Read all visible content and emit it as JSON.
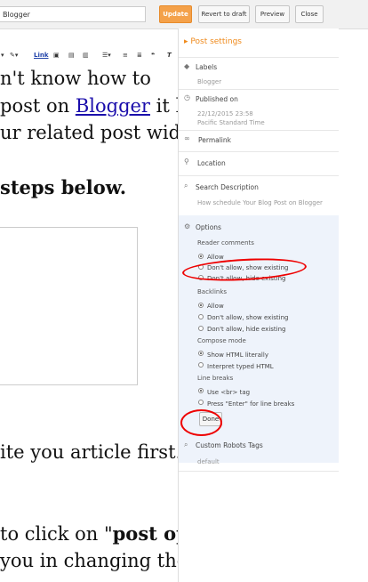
{
  "topbar": {
    "title_value": "Blogger",
    "update_label": "Update",
    "draft_label": "Revert to draft",
    "preview_label": "Preview",
    "close_label": "Close"
  },
  "toolbar": {
    "link_label": "Link"
  },
  "editor": {
    "lines": [
      {
        "text": "n't know how to"
      },
      {
        "prefix": "post on ",
        "link": "Blogger",
        "suffix": " it h"
      },
      {
        "text": "ur related post widg"
      },
      {
        "text": " steps below."
      },
      {
        "text": "ite you article first."
      },
      {
        "prefix": "to click on  \"",
        "bold": "post op",
        "suffix": ""
      },
      {
        "text": "you in changing the"
      }
    ]
  },
  "sidebar": {
    "post_settings": "Post settings",
    "labels": {
      "title": "Labels",
      "value": "Blogger"
    },
    "published": {
      "title": "Published on",
      "date": "22/12/2015 23:58",
      "tz": "Pacific Standard Time"
    },
    "permalink": "Permalink",
    "location": "Location",
    "search": {
      "title": "Search Description",
      "value": "How schedule Your Blog Post on Blogger"
    },
    "options": {
      "title": "Options",
      "reader_comments": "Reader comments",
      "rc_allow": "Allow",
      "rc_dont_show": "Don't allow, show existing",
      "rc_dont_hide": "Don't allow, hide existing",
      "backlinks": "Backlinks",
      "bl_allow": "Allow",
      "bl_dont_show": "Don't allow, show existing",
      "bl_dont_hide": "Don't allow, hide existing",
      "compose_mode": "Compose mode",
      "cm_html": "Show HTML literally",
      "cm_typed": "Interpret typed HTML",
      "line_breaks": "Line breaks",
      "lb_br": "Use <br> tag",
      "lb_enter": "Press \"Enter\" for line breaks",
      "done": "Done"
    },
    "robots": {
      "title": "Custom Robots Tags",
      "value": "default"
    }
  },
  "colors": {
    "accent": "#ef8a1c",
    "update_btn": "#f4a14a",
    "annotation": "#e00000",
    "options_bg": "#eef3fb"
  }
}
